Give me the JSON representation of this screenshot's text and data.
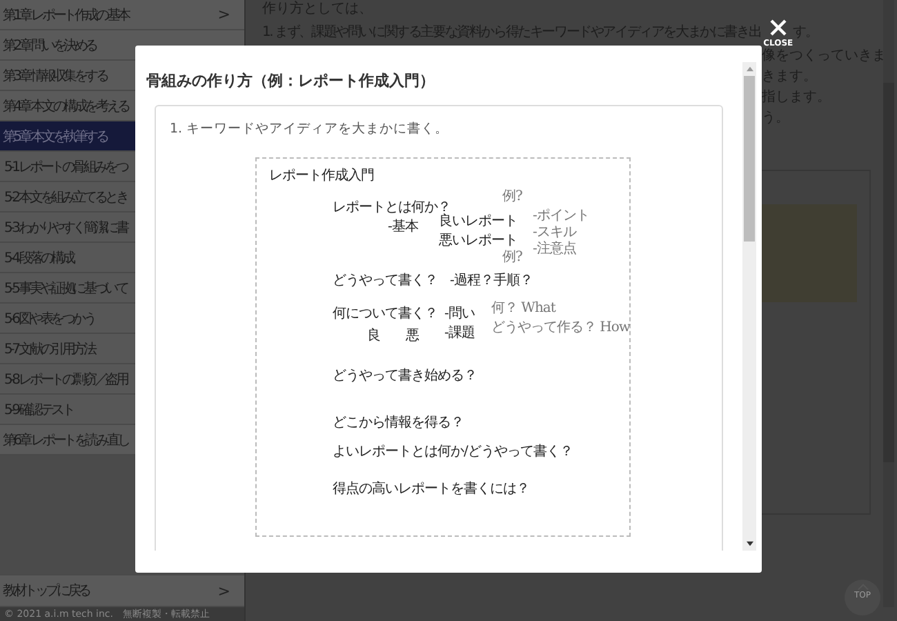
{
  "sidebar": {
    "items": [
      {
        "label": "第1章 レポート作成の基本",
        "kind": "chapter",
        "selected": false,
        "arrow": ">"
      },
      {
        "label": "第2章 問いを決める",
        "kind": "chapter",
        "selected": false
      },
      {
        "label": "第3章 情報収集をする",
        "kind": "chapter",
        "selected": false
      },
      {
        "label": "第4章 本文の構成を考える",
        "kind": "chapter",
        "selected": false
      },
      {
        "label": "第5章 本文を執筆する",
        "kind": "chapter",
        "selected": true
      },
      {
        "label": "5-1 レポートの骨組みをつ",
        "kind": "section",
        "selected": false
      },
      {
        "label": "5-2 本文を組み立てるとき",
        "kind": "section",
        "selected": false
      },
      {
        "label": "5-3 わかりやすく簡潔に書",
        "kind": "section",
        "selected": false
      },
      {
        "label": "5-4 段落の構成",
        "kind": "section",
        "selected": false
      },
      {
        "label": "5-5 事実や証拠に基づいて",
        "kind": "section",
        "selected": false
      },
      {
        "label": "5-6 図や表をつかう",
        "kind": "section",
        "selected": false
      },
      {
        "label": "5-7 文献の引用方法",
        "kind": "section",
        "selected": false
      },
      {
        "label": "5-8 レポートの剽窃／盗用",
        "kind": "section",
        "selected": false
      },
      {
        "label": "5-9 確認テスト",
        "kind": "section",
        "selected": false
      },
      {
        "label": "第6章 レポートを読み直し",
        "kind": "chapter",
        "selected": false
      }
    ],
    "back_link": {
      "label": "教材トップに戻る",
      "arrow": ">"
    },
    "copyright": "© 2021 a.i.m tech inc.　無断複製・転載禁止"
  },
  "content": {
    "intro": "作り方としては、",
    "step_before": "1. まず、課題や問いに関する主要な資料から得たキーワードやアイディアを大まかに書き出",
    "step_after": "す。",
    "fragments": [
      "像をつくっていきま",
      "きます。",
      "指します。",
      "う。"
    ],
    "top_button": "TOP"
  },
  "modal": {
    "title": "骨組みの作り方（例：レポート作成入門）",
    "close_label": "CLOSE",
    "step": "1. キーワードやアイディアを大まかに書く。",
    "sketch": {
      "notes": [
        {
          "text": "レポート作成入門",
          "faded": false
        },
        {
          "text": "例?",
          "faded": true
        },
        {
          "text": "レポートとは何か？",
          "faded": false
        },
        {
          "text": "良いレポート",
          "faded": false
        },
        {
          "text": "-ポイント",
          "faded": true
        },
        {
          "text": "-スキル",
          "faded": true
        },
        {
          "text": "-注意点",
          "faded": true
        },
        {
          "text": "-基本",
          "faded": false
        },
        {
          "text": "悪いレポート",
          "faded": false
        },
        {
          "text": "例?",
          "faded": true
        },
        {
          "text": "どうやって書く？",
          "faded": false
        },
        {
          "text": "-過程？手順？",
          "faded": false
        },
        {
          "text": "何について書く？",
          "faded": false
        },
        {
          "text": "-問い",
          "faded": false
        },
        {
          "text": "何？ What",
          "faded": true
        },
        {
          "text": "良",
          "faded": false
        },
        {
          "text": "悪",
          "faded": false
        },
        {
          "text": "-課題",
          "faded": false
        },
        {
          "text": "どうやって作る？ How",
          "faded": true
        },
        {
          "text": "どうやって書き始める？",
          "faded": false
        },
        {
          "text": "どこから情報を得る？",
          "faded": false
        },
        {
          "text": "よいレポートとは何か/どうやって書く？",
          "faded": false
        },
        {
          "text": "得点の高いレポートを書くには？",
          "faded": false
        }
      ]
    }
  }
}
